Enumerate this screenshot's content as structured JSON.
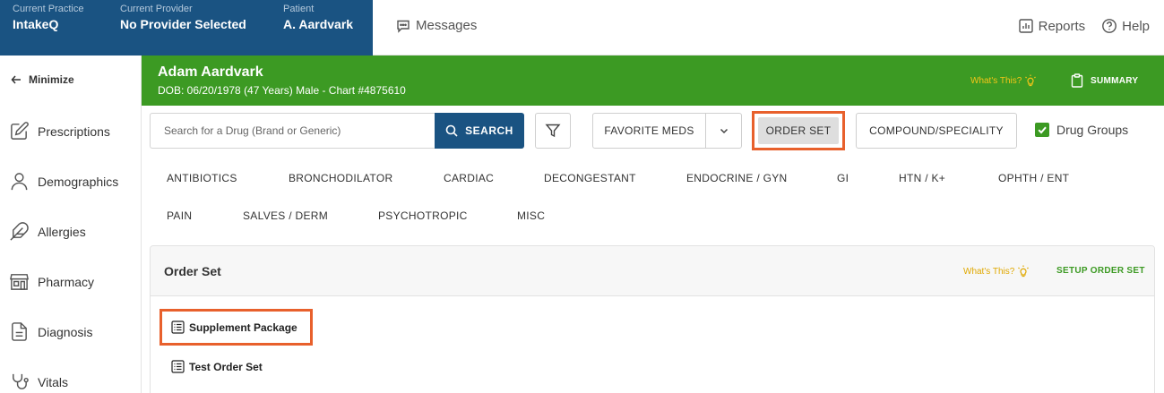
{
  "header": {
    "practice_label": "Current Practice",
    "practice_value": "IntakeQ",
    "provider_label": "Current Provider",
    "provider_value": "No Provider Selected",
    "patient_label": "Patient",
    "patient_value": "A. Aardvark",
    "messages": "Messages",
    "reports": "Reports",
    "help": "Help"
  },
  "sidebar": {
    "minimize": "Minimize",
    "items": [
      {
        "label": "Prescriptions",
        "icon": "edit-icon"
      },
      {
        "label": "Demographics",
        "icon": "person-icon"
      },
      {
        "label": "Allergies",
        "icon": "feather-icon"
      },
      {
        "label": "Pharmacy",
        "icon": "store-icon"
      },
      {
        "label": "Diagnosis",
        "icon": "document-icon"
      },
      {
        "label": "Vitals",
        "icon": "vitals-icon"
      }
    ]
  },
  "patient": {
    "name": "Adam Aardvark",
    "info": "DOB: 06/20/1978 (47 Years) Male - Chart #4875610",
    "whats_this": "What's This?",
    "summary": "SUMMARY"
  },
  "toolbar": {
    "search_placeholder": "Search for a Drug (Brand or Generic)",
    "search_button": "SEARCH",
    "favorite_meds": "FAVORITE MEDS",
    "order_set": "ORDER SET",
    "compound": "COMPOUND/SPECIALITY",
    "drug_groups": "Drug Groups",
    "drug_groups_checked": true
  },
  "categories": {
    "row1": [
      "ANTIBIOTICS",
      "BRONCHODILATOR",
      "CARDIAC",
      "DECONGESTANT",
      "ENDOCRINE / GYN",
      "GI",
      "HTN / K+",
      "OPHTH / ENT"
    ],
    "row2": [
      "PAIN",
      "SALVES / DERM",
      "PSYCHOTROPIC",
      "MISC"
    ]
  },
  "order_set_panel": {
    "title": "Order Set",
    "whats_this": "What's This?",
    "setup": "SETUP ORDER SET",
    "items": [
      "Supplement Package",
      "Test Order Set"
    ]
  },
  "colors": {
    "navy": "#1a5382",
    "green": "#3c9a23",
    "highlight": "#e8602c",
    "whats_this_yellow": "#f5c518"
  }
}
